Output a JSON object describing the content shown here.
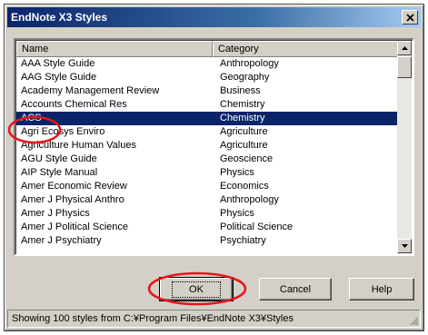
{
  "window": {
    "title": "EndNote X3 Styles"
  },
  "icons": {
    "close": "close-icon",
    "up": "arrow-up-icon",
    "down": "arrow-down-icon",
    "grip": "resize-grip-icon"
  },
  "list": {
    "columns": [
      "Name",
      "Category"
    ],
    "rows": [
      {
        "name": "AAA Style Guide",
        "category": "Anthropology"
      },
      {
        "name": "AAG Style Guide",
        "category": "Geography"
      },
      {
        "name": "Academy Management Review",
        "category": "Business"
      },
      {
        "name": "Accounts Chemical Res",
        "category": "Chemistry"
      },
      {
        "name": "ACS",
        "category": "Chemistry",
        "selected": true
      },
      {
        "name": "Agri Ecosys Enviro",
        "category": "Agriculture"
      },
      {
        "name": "Agriculture Human Values",
        "category": "Agriculture"
      },
      {
        "name": "AGU Style Guide",
        "category": "Geoscience"
      },
      {
        "name": "AIP Style Manual",
        "category": "Physics"
      },
      {
        "name": "Amer Economic Review",
        "category": "Economics"
      },
      {
        "name": "Amer J Physical Anthro",
        "category": "Anthropology"
      },
      {
        "name": "Amer J Physics",
        "category": "Physics"
      },
      {
        "name": "Amer J Political Science",
        "category": "Political Science"
      },
      {
        "name": "Amer J Psychiatry",
        "category": "Psychiatry"
      }
    ]
  },
  "buttons": {
    "ok": "OK",
    "cancel": "Cancel",
    "help": "Help"
  },
  "status": "Showing 100 styles from C:¥Program Files¥EndNote X3¥Styles",
  "colors": {
    "selection": "#0a246a",
    "annotation": "#e8141a",
    "face": "#d4d0c8"
  }
}
